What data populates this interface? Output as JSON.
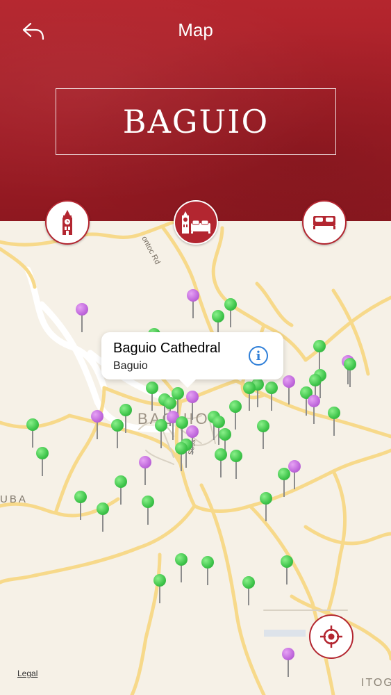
{
  "header": {
    "title": "Map",
    "city": "BAGUIO",
    "back_icon": "back-arrow-icon",
    "accent_color": "#b32630"
  },
  "categories": [
    {
      "icon": "clock-tower-icon",
      "selected": false
    },
    {
      "icon": "tower-and-bed-icon",
      "selected": true
    },
    {
      "icon": "bed-icon",
      "selected": false
    }
  ],
  "map": {
    "callout": {
      "title": "Baguio Cathedral",
      "subtitle": "Baguio"
    },
    "labels": {
      "road": "ontoc Rd",
      "city": "BAGUIO",
      "west": "UBA",
      "southeast": "ITOG",
      "street": "Sess"
    },
    "legal": "Legal",
    "pin_colors": {
      "attraction": "#3ec44a",
      "lodging": "#c068dc"
    }
  }
}
